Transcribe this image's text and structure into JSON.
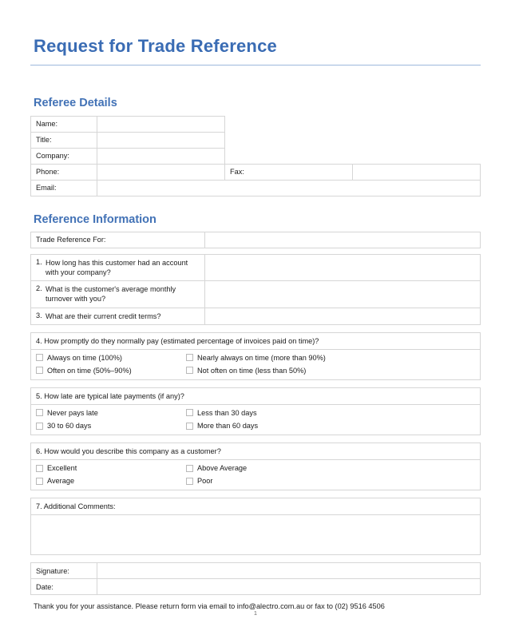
{
  "document": {
    "title": "Request for Trade Reference",
    "page_number": "1",
    "footer_note": "Thank you for your assistance. Please return form via email to info@alectro.com.au or fax to (02) 9516 4506",
    "accent_color": "#3a6cb4",
    "heading_color": "#4272b6",
    "rule_color": "#9db8dc",
    "border_color": "#d6d6d6"
  },
  "referee_details": {
    "heading": "Referee Details",
    "rows": [
      {
        "label": "Name:",
        "value": ""
      },
      {
        "label": "Title:",
        "value": ""
      },
      {
        "label": "Company:",
        "value": ""
      }
    ],
    "phone_row": {
      "phone_label": "Phone:",
      "phone_value": "",
      "fax_label": "Fax:",
      "fax_value": ""
    },
    "email_row": {
      "label": "Email:",
      "value": ""
    }
  },
  "reference_information": {
    "heading": "Reference Information",
    "trade_reference_for": {
      "label": "Trade Reference For:",
      "value": ""
    },
    "questions": [
      {
        "number": "1.",
        "text": "How long has this customer had an account with your company?",
        "answer": ""
      },
      {
        "number": "2.",
        "text": "What is the customer's average monthly turnover with you?",
        "answer": ""
      },
      {
        "number": "3.",
        "text": "What are their current credit terms?",
        "answer": ""
      }
    ],
    "question4": {
      "heading": "4. How promptly do they normally pay (estimated percentage of invoices paid on time)?",
      "options": [
        {
          "label": "Always on time (100%)",
          "checked": false
        },
        {
          "label": "Nearly always on time (more than 90%)",
          "checked": false
        },
        {
          "label": "Often on time (50%–90%)",
          "checked": false
        },
        {
          "label": "Not often on time (less than 50%)",
          "checked": false
        }
      ]
    },
    "question5": {
      "heading": "5. How late are typical late payments (if any)?",
      "options": [
        {
          "label": "Never pays late",
          "checked": false
        },
        {
          "label": "Less than 30 days",
          "checked": false
        },
        {
          "label": "30 to 60 days",
          "checked": false
        },
        {
          "label": "More than 60 days",
          "checked": false
        }
      ]
    },
    "question6": {
      "heading": "6. How would you describe this company as a customer?",
      "options": [
        {
          "label": "Excellent",
          "checked": false
        },
        {
          "label": "Above Average",
          "checked": false
        },
        {
          "label": "Average",
          "checked": false
        },
        {
          "label": "Poor",
          "checked": false
        }
      ]
    },
    "question7": {
      "heading": "7. Additional Comments:",
      "value": ""
    }
  },
  "signature_block": {
    "signature_label": "Signature:",
    "signature_value": "",
    "date_label": "Date:",
    "date_value": ""
  }
}
